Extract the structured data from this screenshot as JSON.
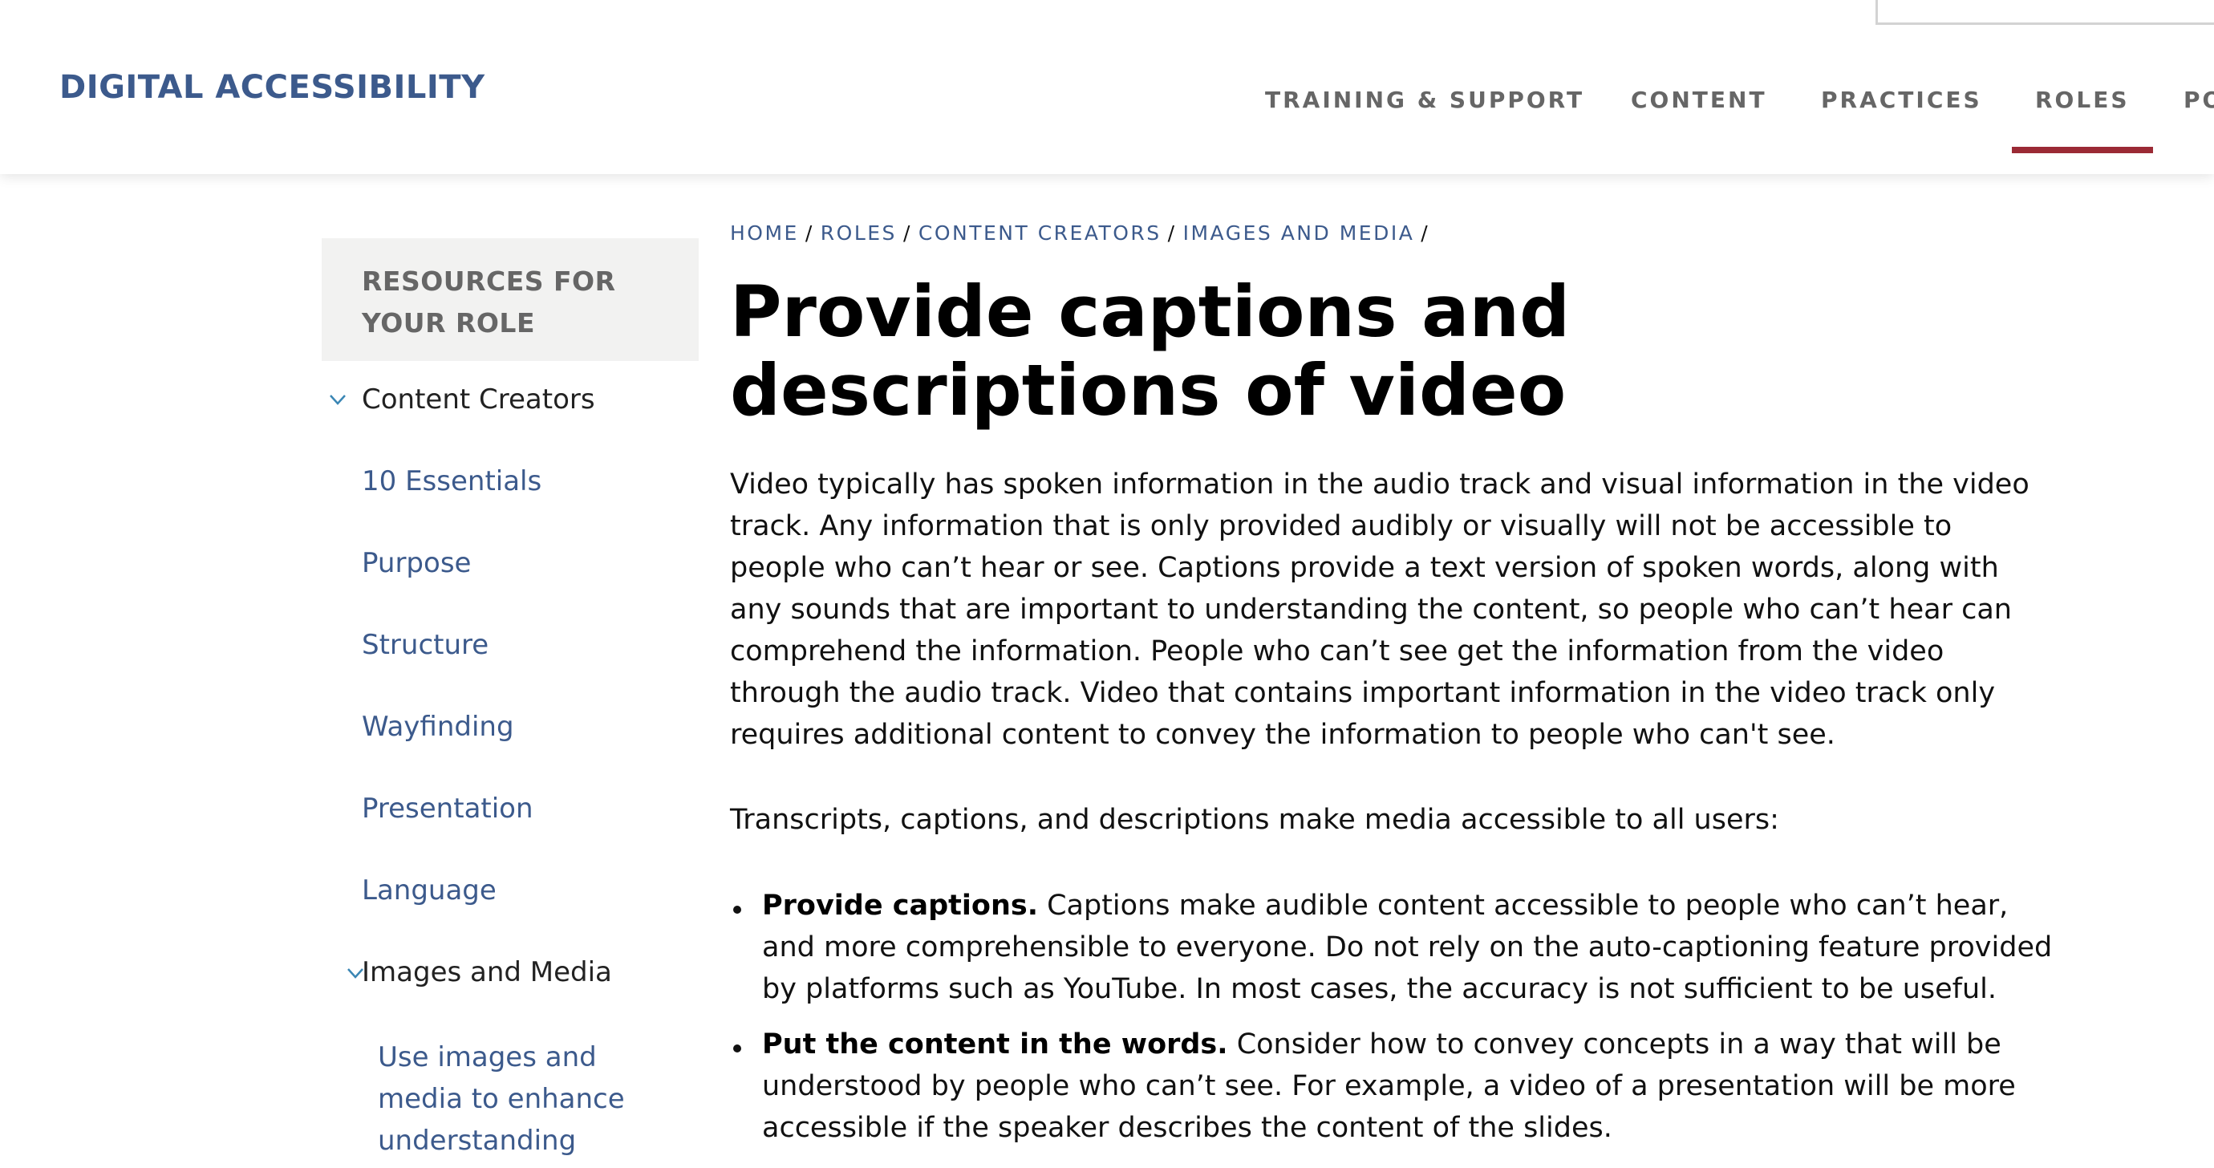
{
  "header": {
    "site_title": "DIGITAL ACCESSIBILITY",
    "nav": [
      {
        "label": "TRAINING & SUPPORT",
        "active": false
      },
      {
        "label": "CONTENT",
        "active": false
      },
      {
        "label": "PRACTICES",
        "active": false
      },
      {
        "label": "ROLES",
        "active": true
      },
      {
        "label": "PO",
        "active": false
      }
    ],
    "accent_color": "#9b2a35"
  },
  "sidebar": {
    "heading_line1": "RESOURCES FOR",
    "heading_line2": "YOUR ROLE",
    "section": {
      "label": "Content Creators",
      "icon": "chevron-down-icon",
      "expanded": true
    },
    "items": [
      {
        "label": "10 Essentials"
      },
      {
        "label": "Purpose"
      },
      {
        "label": "Structure"
      },
      {
        "label": "Wayfinding"
      },
      {
        "label": "Presentation"
      },
      {
        "label": "Language"
      }
    ],
    "subsection": {
      "label": "Images and Media",
      "icon": "chevron-down-icon",
      "expanded": true
    },
    "sub_items": [
      {
        "label": "Use images and media to enhance understanding"
      }
    ],
    "link_color": "#3c5a8c"
  },
  "main": {
    "breadcrumb": [
      "HOME",
      "ROLES",
      "CONTENT CREATORS",
      "IMAGES AND MEDIA"
    ],
    "breadcrumb_separator": "/",
    "title": "Provide captions and descriptions of video",
    "paragraph1": "Video typically has spoken information in the audio track and visual information in the video track. Any information that is only provided audibly or visually will not be accessible to people who can’t hear or see. Captions provide a text version of spoken words, along with any sounds that are important to understanding the content, so people who can’t hear can comprehend the information. People who can’t see get the information from the video through the audio track. Video that contains important information in the video track only requires additional content to convey the information to people who can't see.",
    "paragraph2": "Transcripts, captions, and descriptions make media accessible to all users:",
    "bullets": [
      {
        "bold": "Provide captions.",
        "text": " Captions make audible content accessible to people who can’t hear, and more comprehensible to everyone. Do not rely on the auto-captioning feature provided by platforms such as YouTube. In most cases, the accuracy is not sufficient to be useful."
      },
      {
        "bold": "Put the content in the words.",
        "text": " Consider how to convey concepts in a way that will be understood by people who can’t see. For example, a video of a presentation will be more accessible if the speaker describes the content of the slides."
      }
    ]
  }
}
